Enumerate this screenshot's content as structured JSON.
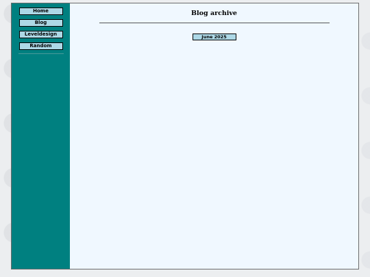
{
  "nav": {
    "items": [
      {
        "label": "Home"
      },
      {
        "label": "Blog"
      },
      {
        "label": "Leveldesign"
      },
      {
        "label": "Random"
      }
    ]
  },
  "main": {
    "title": "Blog archive",
    "archive": [
      {
        "label": "June 2025"
      }
    ]
  },
  "colors": {
    "sidebar": "#008080",
    "content_background": "#f0f8ff",
    "button": "#add8e6"
  }
}
